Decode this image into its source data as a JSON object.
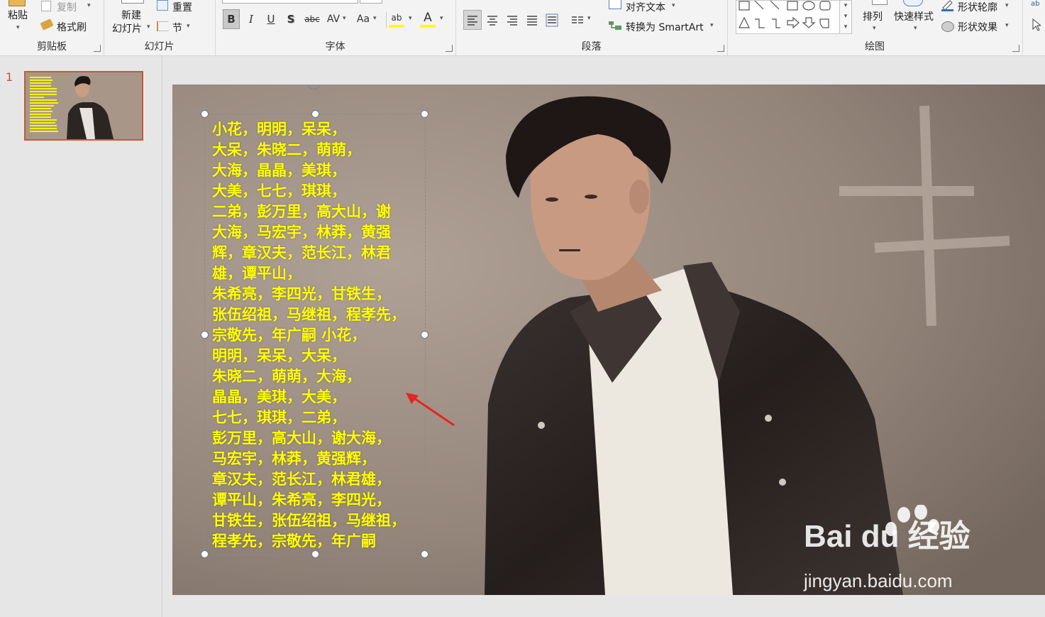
{
  "ribbon": {
    "clipboard": {
      "label": "剪贴板",
      "paste": "粘贴",
      "copy": "复制",
      "format_painter": "格式刷"
    },
    "slides": {
      "label": "幻灯片",
      "new_slide_line1": "新建",
      "new_slide_line2": "幻灯片",
      "reset": "重置",
      "section": "节"
    },
    "font": {
      "label": "字体",
      "bold": "B",
      "italic": "I",
      "underline": "U",
      "shadow": "S",
      "strike": "abc",
      "spacing": "AV",
      "case": "Aa",
      "highlight": "ab",
      "font_color": "A"
    },
    "paragraph": {
      "label": "段落",
      "align_text": "对齐文本",
      "convert_smartart": "转换为 SmartArt"
    },
    "drawing": {
      "label": "绘图",
      "arrange": "排列",
      "quick_styles": "快速样式",
      "shape_outline": "形状轮廓",
      "shape_effects": "形状效果"
    }
  },
  "left_pane": {
    "slide_number": "1"
  },
  "slide": {
    "text_lines": [
      "小花，明明，呆呆，",
      "大呆，朱晓二，萌萌，",
      "大海，晶晶，美琪，",
      "大美，七七，琪琪，",
      "二弟，彭万里，高大山，谢",
      "大海，马宏宇，林莽，黄强",
      "辉，章汉夫，范长江，林君",
      "雄，谭平山，",
      "朱希亮，李四光，甘铁生，",
      "张伍绍祖，马继祖，程孝先，",
      "宗敬先，年广嗣 小花，",
      "明明，呆呆，大呆，",
      "朱晓二，萌萌，大海，",
      "晶晶，美琪，大美，",
      "七七，琪琪，二弟，",
      "彭万里，高大山，谢大海，",
      "马宏宇，林莽，黄强辉，",
      "章汉夫，范长江，林君雄，",
      "谭平山，朱希亮，李四光，",
      "甘铁生，张伍绍祖，马继祖，",
      "程孝先，宗敬先，年广嗣"
    ],
    "watermark_logo": "Bai du 经验",
    "watermark_url": "jingyan.baidu.com"
  },
  "colors": {
    "text_yellow": "#ffff00",
    "thumb_border": "#c55a36",
    "arrow": "#e8231b"
  }
}
